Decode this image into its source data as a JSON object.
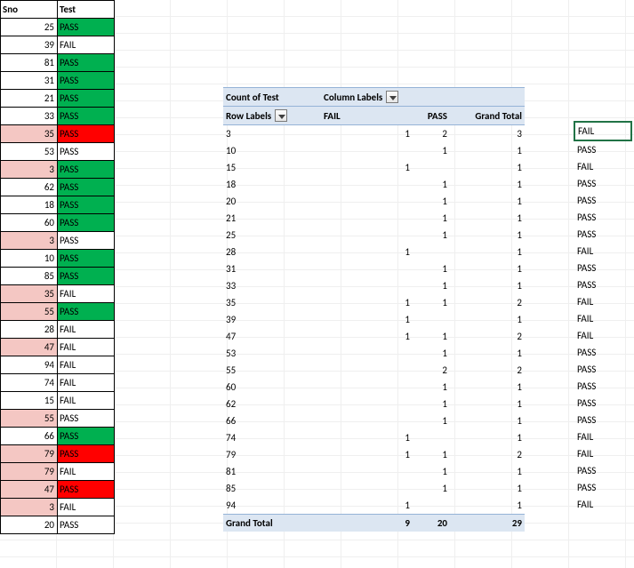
{
  "data_table": {
    "headers": {
      "sno": "Sno",
      "test": "Test"
    },
    "rows": [
      {
        "sno": "25",
        "test": "PASS",
        "sno_bg": "white",
        "test_bg": "green"
      },
      {
        "sno": "39",
        "test": "FAIL",
        "sno_bg": "white",
        "test_bg": "white"
      },
      {
        "sno": "81",
        "test": "PASS",
        "sno_bg": "white",
        "test_bg": "green"
      },
      {
        "sno": "31",
        "test": "PASS",
        "sno_bg": "white",
        "test_bg": "green"
      },
      {
        "sno": "21",
        "test": "PASS",
        "sno_bg": "white",
        "test_bg": "green"
      },
      {
        "sno": "33",
        "test": "PASS",
        "sno_bg": "white",
        "test_bg": "green"
      },
      {
        "sno": "35",
        "test": "PASS",
        "sno_bg": "pink",
        "test_bg": "red"
      },
      {
        "sno": "53",
        "test": "PASS",
        "sno_bg": "white",
        "test_bg": "white"
      },
      {
        "sno": "3",
        "test": "PASS",
        "sno_bg": "pink",
        "test_bg": "green"
      },
      {
        "sno": "62",
        "test": "PASS",
        "sno_bg": "white",
        "test_bg": "green"
      },
      {
        "sno": "18",
        "test": "PASS",
        "sno_bg": "white",
        "test_bg": "green"
      },
      {
        "sno": "60",
        "test": "PASS",
        "sno_bg": "white",
        "test_bg": "green"
      },
      {
        "sno": "3",
        "test": "PASS",
        "sno_bg": "pink",
        "test_bg": "white"
      },
      {
        "sno": "10",
        "test": "PASS",
        "sno_bg": "white",
        "test_bg": "green"
      },
      {
        "sno": "85",
        "test": "PASS",
        "sno_bg": "white",
        "test_bg": "green"
      },
      {
        "sno": "35",
        "test": "FAIL",
        "sno_bg": "pink",
        "test_bg": "white"
      },
      {
        "sno": "55",
        "test": "PASS",
        "sno_bg": "pink",
        "test_bg": "green"
      },
      {
        "sno": "28",
        "test": "FAIL",
        "sno_bg": "white",
        "test_bg": "white"
      },
      {
        "sno": "47",
        "test": "FAIL",
        "sno_bg": "pink",
        "test_bg": "white"
      },
      {
        "sno": "94",
        "test": "FAIL",
        "sno_bg": "white",
        "test_bg": "white"
      },
      {
        "sno": "74",
        "test": "FAIL",
        "sno_bg": "white",
        "test_bg": "white"
      },
      {
        "sno": "15",
        "test": "FAIL",
        "sno_bg": "white",
        "test_bg": "white"
      },
      {
        "sno": "55",
        "test": "PASS",
        "sno_bg": "pink",
        "test_bg": "white"
      },
      {
        "sno": "66",
        "test": "PASS",
        "sno_bg": "white",
        "test_bg": "green"
      },
      {
        "sno": "79",
        "test": "PASS",
        "sno_bg": "pink",
        "test_bg": "red"
      },
      {
        "sno": "79",
        "test": "FAIL",
        "sno_bg": "pink",
        "test_bg": "white"
      },
      {
        "sno": "47",
        "test": "PASS",
        "sno_bg": "pink",
        "test_bg": "red"
      },
      {
        "sno": "3",
        "test": "FAIL",
        "sno_bg": "pink",
        "test_bg": "white"
      },
      {
        "sno": "20",
        "test": "PASS",
        "sno_bg": "white",
        "test_bg": "white"
      }
    ]
  },
  "pivot": {
    "labels": {
      "count_of_test": "Count of Test",
      "column_labels": "Column Labels",
      "row_labels": "Row Labels",
      "fail": "FAIL",
      "pass": "PASS",
      "grand_total_col": "Grand Total",
      "grand_total_row": "Grand Total"
    },
    "rows": [
      {
        "label": "3",
        "fail": "1",
        "pass": "2",
        "gt": "3"
      },
      {
        "label": "10",
        "fail": "",
        "pass": "1",
        "gt": "1"
      },
      {
        "label": "15",
        "fail": "1",
        "pass": "",
        "gt": "1"
      },
      {
        "label": "18",
        "fail": "",
        "pass": "1",
        "gt": "1"
      },
      {
        "label": "20",
        "fail": "",
        "pass": "1",
        "gt": "1"
      },
      {
        "label": "21",
        "fail": "",
        "pass": "1",
        "gt": "1"
      },
      {
        "label": "25",
        "fail": "",
        "pass": "1",
        "gt": "1"
      },
      {
        "label": "28",
        "fail": "1",
        "pass": "",
        "gt": "1"
      },
      {
        "label": "31",
        "fail": "",
        "pass": "1",
        "gt": "1"
      },
      {
        "label": "33",
        "fail": "",
        "pass": "1",
        "gt": "1"
      },
      {
        "label": "35",
        "fail": "1",
        "pass": "1",
        "gt": "2"
      },
      {
        "label": "39",
        "fail": "1",
        "pass": "",
        "gt": "1"
      },
      {
        "label": "47",
        "fail": "1",
        "pass": "1",
        "gt": "2"
      },
      {
        "label": "53",
        "fail": "",
        "pass": "1",
        "gt": "1"
      },
      {
        "label": "55",
        "fail": "",
        "pass": "2",
        "gt": "2"
      },
      {
        "label": "60",
        "fail": "",
        "pass": "1",
        "gt": "1"
      },
      {
        "label": "62",
        "fail": "",
        "pass": "1",
        "gt": "1"
      },
      {
        "label": "66",
        "fail": "",
        "pass": "1",
        "gt": "1"
      },
      {
        "label": "74",
        "fail": "1",
        "pass": "",
        "gt": "1"
      },
      {
        "label": "79",
        "fail": "1",
        "pass": "1",
        "gt": "2"
      },
      {
        "label": "81",
        "fail": "",
        "pass": "1",
        "gt": "1"
      },
      {
        "label": "85",
        "fail": "",
        "pass": "1",
        "gt": "1"
      },
      {
        "label": "94",
        "fail": "1",
        "pass": "",
        "gt": "1"
      }
    ],
    "totals": {
      "fail": "9",
      "pass": "20",
      "gt": "29"
    }
  },
  "right_column": {
    "values": [
      "FAIL",
      "PASS",
      "FAIL",
      "PASS",
      "PASS",
      "PASS",
      "PASS",
      "FAIL",
      "PASS",
      "PASS",
      "FAIL",
      "FAIL",
      "FAIL",
      "PASS",
      "PASS",
      "PASS",
      "PASS",
      "PASS",
      "FAIL",
      "FAIL",
      "PASS",
      "PASS",
      "FAIL"
    ]
  }
}
